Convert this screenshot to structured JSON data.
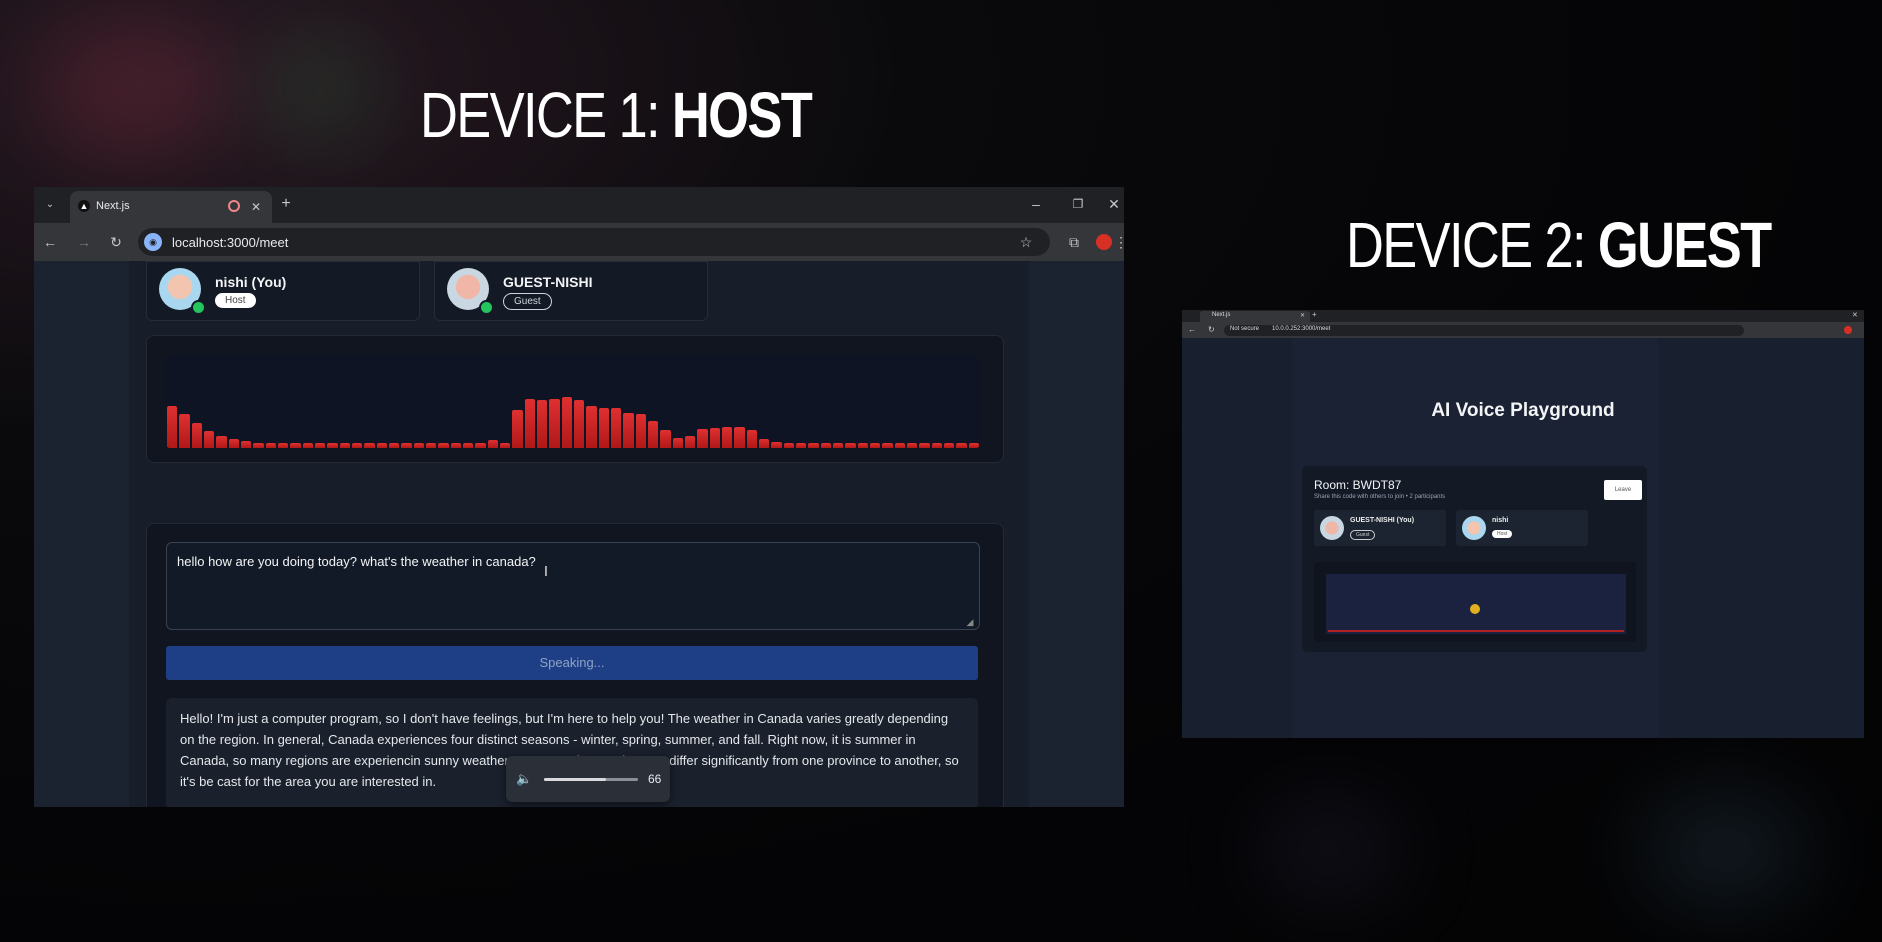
{
  "headings": {
    "device1_prefix": "DEVICE 1: ",
    "device1_role": "HOST",
    "device2_prefix": "DEVICE 2: ",
    "device2_role": "GUEST"
  },
  "host_browser": {
    "tab_title": "Next.js",
    "url": "localhost:3000/meet",
    "participants": [
      {
        "name": "nishi (You)",
        "badge": "Host"
      },
      {
        "name": "GUEST-NISHI",
        "badge": "Guest"
      }
    ],
    "visualizer_levels": [
      0.42,
      0.34,
      0.25,
      0.17,
      0.12,
      0.09,
      0.07,
      0.05,
      0.05,
      0.05,
      0.05,
      0.05,
      0.05,
      0.05,
      0.05,
      0.05,
      0.05,
      0.05,
      0.05,
      0.05,
      0.05,
      0.05,
      0.05,
      0.05,
      0.05,
      0.05,
      0.08,
      0.05,
      0.38,
      0.48,
      0.47,
      0.48,
      0.5,
      0.47,
      0.42,
      0.4,
      0.4,
      0.35,
      0.34,
      0.27,
      0.18,
      0.1,
      0.12,
      0.19,
      0.2,
      0.21,
      0.21,
      0.18,
      0.09,
      0.06,
      0.05,
      0.05,
      0.05,
      0.05,
      0.05,
      0.05,
      0.05,
      0.05,
      0.05,
      0.05,
      0.05,
      0.05,
      0.05,
      0.05,
      0.05,
      0.05
    ],
    "prompt_text": "hello how are you doing today? what's the weather in canada?",
    "speak_button": "Speaking...",
    "response_text": "Hello! I'm just a computer program, so I don't have feelings, but I'm here to help you! The weather in Canada varies greatly depending on the region. In general, Canada experiences four distinct seasons - winter, spring, summer, and fall. Right now, it is summer in Canada, so many regions are experiencin                                       sunny weather. However, the weather can differ significantly from one province to another, so it's be                                        cast for the area you are interested in.",
    "volume": 66,
    "volume_label": "66",
    "colors": {
      "accent": "#1e3f85",
      "bars": "#e03030",
      "online": "#22c55e"
    }
  },
  "guest_browser": {
    "tab_title": "Next.js",
    "security_label": "Not secure",
    "url": "10.0.0.252:3000/meet",
    "app_title": "AI Voice Playground",
    "room_label": "Room: BWDT87",
    "room_subtitle": "Share this code with others to join • 2 participants",
    "leave_button": "Leave",
    "participants": [
      {
        "name": "GUEST-NISHI (You)",
        "badge": "Guest"
      },
      {
        "name": "nishi",
        "badge": "Host"
      }
    ]
  }
}
